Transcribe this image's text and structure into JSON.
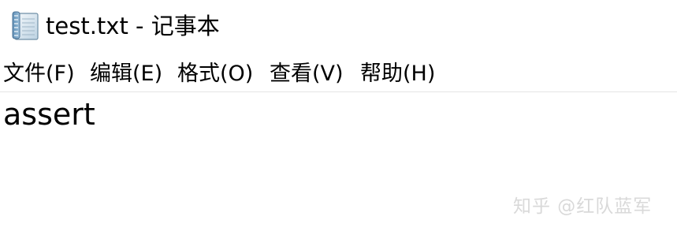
{
  "window": {
    "title": "test.txt - 记事本",
    "icon": "notepad-icon"
  },
  "menu": {
    "file": "文件(F)",
    "edit": "编辑(E)",
    "format": "格式(O)",
    "view": "查看(V)",
    "help": "帮助(H)"
  },
  "editor": {
    "content": "assert"
  },
  "watermark": {
    "text": "知乎 @红队蓝军"
  }
}
